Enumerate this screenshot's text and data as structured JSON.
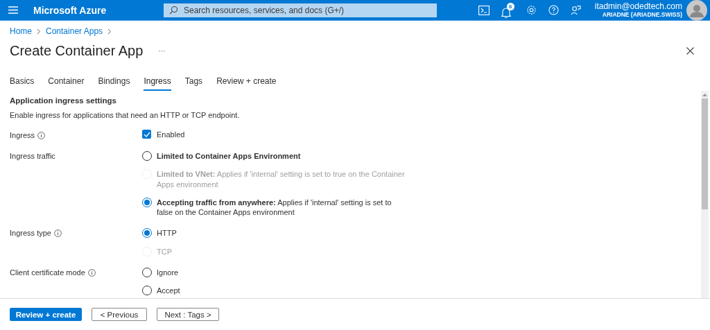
{
  "topbar": {
    "brand": "Microsoft Azure",
    "search": {
      "placeholder": "Search resources, services, and docs (G+/)"
    },
    "notification_count": "6",
    "user": {
      "email": "itadmin@odedtech.com",
      "tenant": "ARIADNE (ARIADNE.SWISS)"
    }
  },
  "breadcrumb": [
    "Home",
    "Container Apps"
  ],
  "title": "Create Container App",
  "more": "···",
  "tabs": [
    {
      "label": "Basics",
      "selected": false
    },
    {
      "label": "Container",
      "selected": false
    },
    {
      "label": "Bindings",
      "selected": false
    },
    {
      "label": "Ingress",
      "selected": true
    },
    {
      "label": "Tags",
      "selected": false
    },
    {
      "label": "Review + create",
      "selected": false
    }
  ],
  "section": {
    "heading": "Application ingress settings",
    "description": "Enable ingress for applications that need an HTTP or TCP endpoint."
  },
  "fields": [
    {
      "label": "Ingress",
      "info": true,
      "kind": "checkbox",
      "checkbox": {
        "label": "Enabled",
        "checked": true
      }
    },
    {
      "label": "Ingress traffic",
      "info": false,
      "kind": "radio",
      "options": [
        {
          "text": "Limited to Container Apps Environment",
          "bold": true,
          "selected": false,
          "disabled": false
        },
        {
          "text": "**Limited to VNet:** Applies if 'internal' setting is set to true on the Container Apps environment",
          "bold": false,
          "selected": false,
          "disabled": true
        },
        {
          "text": "**Accepting traffic from anywhere:** Applies if 'internal' setting is set to false on the Container Apps environment",
          "bold": false,
          "selected": true,
          "disabled": false
        }
      ]
    },
    {
      "label": "Ingress type",
      "info": true,
      "kind": "radio",
      "options": [
        {
          "text": "HTTP",
          "bold": false,
          "selected": true,
          "disabled": false
        },
        {
          "text": "TCP",
          "bold": false,
          "selected": false,
          "disabled": true
        }
      ]
    },
    {
      "label": "Client certificate mode",
      "info": true,
      "kind": "radio",
      "options": [
        {
          "text": "Ignore",
          "bold": false,
          "selected": false,
          "disabled": false
        },
        {
          "text": "Accept",
          "bold": false,
          "selected": false,
          "disabled": false
        }
      ]
    }
  ],
  "footer": [
    {
      "label": "Review + create",
      "kind": "primary"
    },
    {
      "label": "< Previous",
      "kind": "secondary"
    },
    {
      "label": "Next : Tags >",
      "kind": "secondary"
    }
  ]
}
